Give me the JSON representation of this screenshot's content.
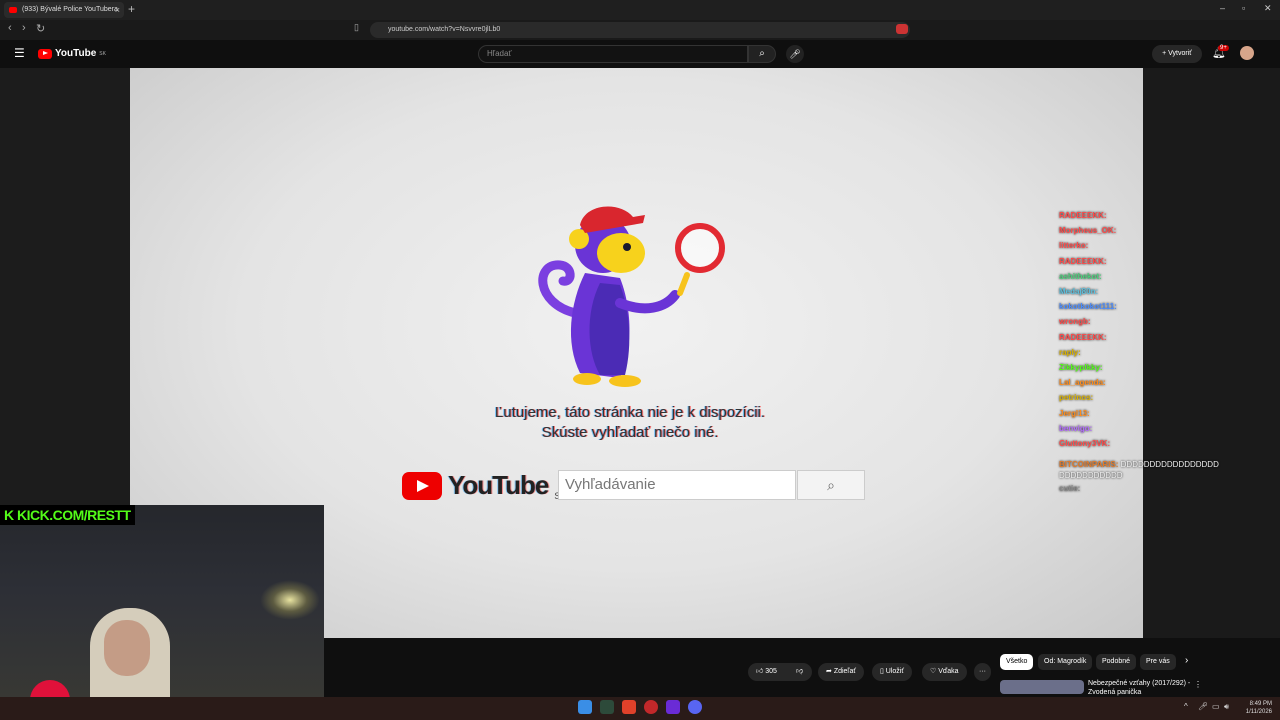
{
  "browser": {
    "tab_title": "(933) Bývalé Police YouTubera",
    "url": "youtube.com/watch?v=Nsvvre0jlLb0"
  },
  "youtube": {
    "logo": "YouTube",
    "country_code": "SK",
    "search_placeholder": "Hľadať",
    "create_label": "Vytvoriť",
    "notifications_count": "9+"
  },
  "error_page": {
    "line1": "Ľutujeme, táto stránka nie je k dispozícii.",
    "line2": "Skúste vyhľadať niečo iné.",
    "logo": "YouTube",
    "logo_suffix": "SK",
    "search_placeholder": "Vyhľadávanie"
  },
  "stream": {
    "kick_label": "KICK.COM/RESTT"
  },
  "chat": [
    {
      "user": "RADEEEKK:",
      "color": "#ff4a4a",
      "msg": ""
    },
    {
      "user": "Morpheus_OK:",
      "color": "#ff4a4a",
      "msg": ""
    },
    {
      "user": "litterko:",
      "color": "#ff4a4a",
      "msg": ""
    },
    {
      "user": "RADEEEKK:",
      "color": "#ff4a4a",
      "msg": ""
    },
    {
      "user": "ashithekot:",
      "color": "#48d17a",
      "msg": ""
    },
    {
      "user": "Medaj80n:",
      "color": "#5bc0de",
      "msg": ""
    },
    {
      "user": "kokotkokot111:",
      "color": "#4a8cff",
      "msg": ""
    },
    {
      "user": "wrongb:",
      "color": "#ff4a4a",
      "msg": ""
    },
    {
      "user": "RADEEEKK:",
      "color": "#ff4a4a",
      "msg": ""
    },
    {
      "user": "raply:",
      "color": "#d9b100",
      "msg": ""
    },
    {
      "user": "Zikkyplkky:",
      "color": "#53fc18",
      "msg": ""
    },
    {
      "user": "Lal_agenda:",
      "color": "#ff8c1a",
      "msg": ""
    },
    {
      "user": "petrinos:",
      "color": "#d9b100",
      "msg": ""
    },
    {
      "user": "Jergl13:",
      "color": "#ff8c1a",
      "msg": ""
    },
    {
      "user": "benvigo:",
      "color": "#b36bff",
      "msg": ""
    },
    {
      "user": "Gluttony3VK:",
      "color": "#ff4a4a",
      "msg": ""
    },
    {
      "user": "BITCOINPARIS:",
      "color": "#e07a2a",
      "msg": "DDDDDDDDDDDDDDDDD DDDDDDDDDDD"
    },
    {
      "user": "cutie:",
      "color": "#888888",
      "msg": ""
    }
  ],
  "actions": {
    "likes": "305",
    "share": "Zdieľať",
    "save": "Uložiť",
    "thanks": "Vďaka",
    "more": "···"
  },
  "chips": [
    "Všetko",
    "Od: Magrodík",
    "Podobné",
    "Pre vás"
  ],
  "recommendation": {
    "title": "Nebezpečné vzťahy (2017/292) - Zvodená panička"
  },
  "taskbar": {
    "time": "8:49 PM",
    "date": "1/11/2026"
  }
}
